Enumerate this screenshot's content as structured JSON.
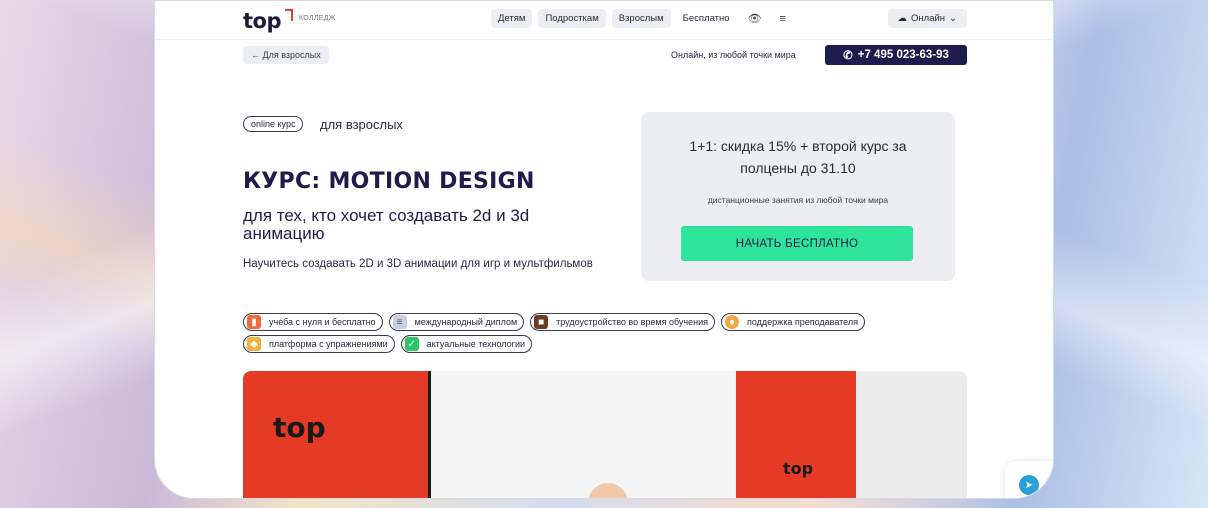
{
  "header": {
    "logo_word": "top",
    "logo_sub": "КОЛЛЕДЖ",
    "nav": [
      "Детям",
      "Подросткам",
      "Взрослым"
    ],
    "nav_plain": "Бесплатно",
    "accessibility_icon": "eye-icon",
    "menu_icon": "hamburger-icon",
    "online_label": "Онлайн",
    "online_icon": "cloud-icon"
  },
  "subheader": {
    "back_label": "← Для взрослых",
    "online_note": "Онлайн, из любой точки мира",
    "phone": "+7 495 023-63-93",
    "phone_icon": "phone-icon"
  },
  "hero": {
    "pill": "online курс",
    "for_whom": "для взрослых",
    "title": "КУРС: MOTION DESIGN",
    "subtitle": "для тех, кто хочет создавать 2d и 3d анимацию",
    "description": "Научитесь создавать 2D и 3D анимации для игр и мультфильмов"
  },
  "promo": {
    "title": "1+1: скидка 15% + второй курс за полцены до 31.10",
    "note": "дистанционные занятия из любой точки мира",
    "cta": "НАЧАТЬ БЕСПЛАТНО"
  },
  "tags": [
    {
      "label": "учеба с нуля и бесплатно",
      "icon": "gift-icon",
      "color": "#f06a3a",
      "glyph": "▮"
    },
    {
      "label": "международный диплом",
      "icon": "document-icon",
      "color": "#c9cde8",
      "glyph": "≡"
    },
    {
      "label": "трудоустройство во время обучения",
      "icon": "briefcase-icon",
      "color": "#6b3b22",
      "glyph": "■"
    },
    {
      "label": "поддержка преподавателя",
      "icon": "teacher-icon",
      "color": "#f2a93b",
      "glyph": "●"
    },
    {
      "label": "платформа с упражнениями",
      "icon": "handshake-icon",
      "color": "#f2b33b",
      "glyph": "◆"
    },
    {
      "label": "актуальные технологии",
      "icon": "check-icon",
      "color": "#2ec46a",
      "glyph": "✓"
    }
  ],
  "photo": {
    "logo_text": "top"
  },
  "telegram_icon": "telegram-icon"
}
